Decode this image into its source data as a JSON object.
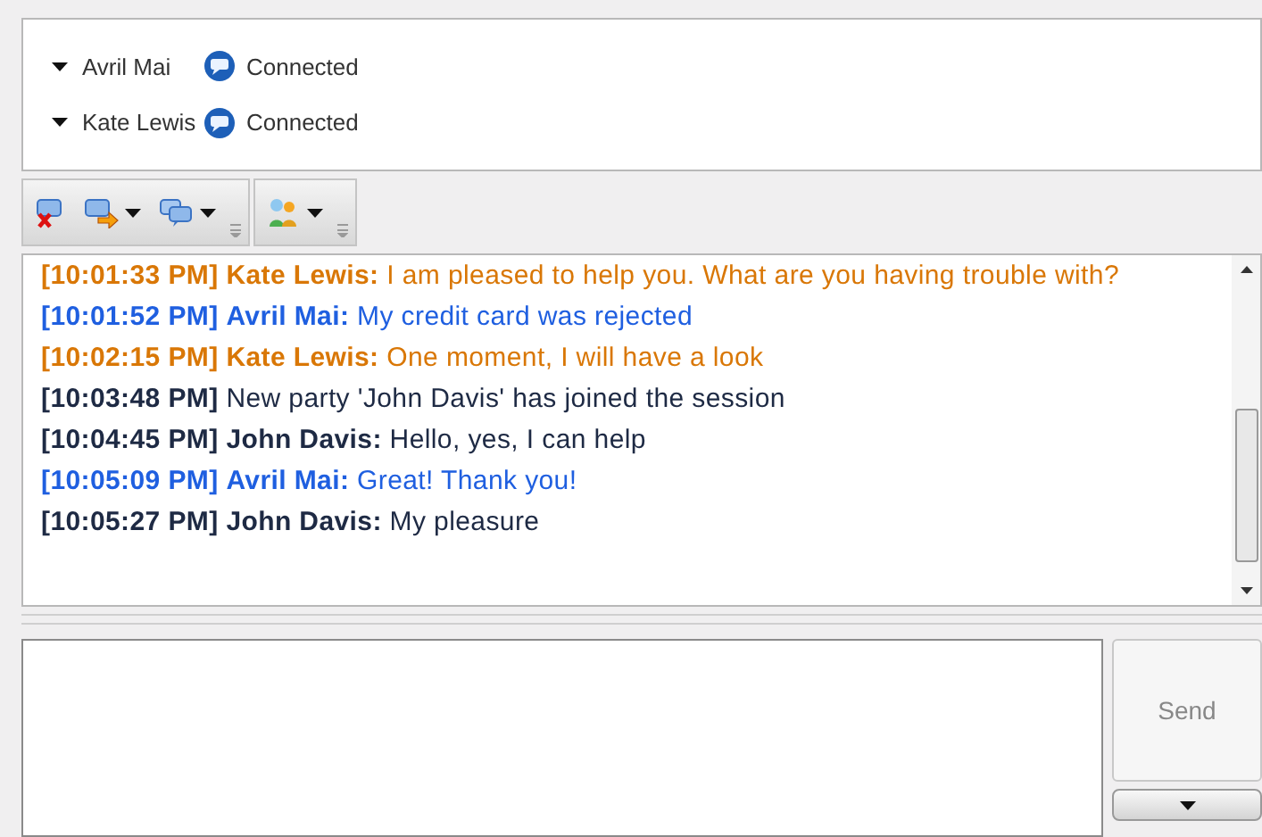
{
  "participants": [
    {
      "name": "Avril Mai",
      "status": "Connected"
    },
    {
      "name": "Kate Lewis",
      "status": "Connected"
    }
  ],
  "toolbar": [
    {
      "kind": "remove",
      "dropdown": false
    },
    {
      "kind": "transfer",
      "dropdown": true
    },
    {
      "kind": "conference",
      "dropdown": true
    },
    {
      "kind": "party",
      "dropdown": true
    }
  ],
  "messages": [
    {
      "kind": "message",
      "time": "[10:01:33 PM]",
      "sender": "Kate Lewis:",
      "text": "I am pleased to help you. What are you having trouble with?",
      "color": "#d97706"
    },
    {
      "kind": "message",
      "time": "[10:01:52 PM]",
      "sender": "Avril Mai:",
      "text": "My credit card was rejected",
      "color": "#1f5fe0"
    },
    {
      "kind": "message",
      "time": "[10:02:15 PM]",
      "sender": "Kate Lewis:",
      "text": "One moment, I will have a look",
      "color": "#d97706"
    },
    {
      "kind": "system",
      "time": "[10:03:48 PM]",
      "text": "New party 'John Davis' has joined the session",
      "color": "#1e2a44"
    },
    {
      "kind": "message",
      "time": "[10:04:45 PM]",
      "sender": "John Davis:",
      "text": "Hello, yes, I can help",
      "color": "#1e2a44"
    },
    {
      "kind": "message",
      "time": "[10:05:09 PM]",
      "sender": "Avril Mai:",
      "text": "Great! Thank you!",
      "color": "#1f5fe0"
    },
    {
      "kind": "message",
      "time": "[10:05:27 PM]",
      "sender": "John Davis:",
      "text": "My pleasure",
      "color": "#1e2a44"
    }
  ],
  "send_button": {
    "label": "Send",
    "disabled": true
  }
}
